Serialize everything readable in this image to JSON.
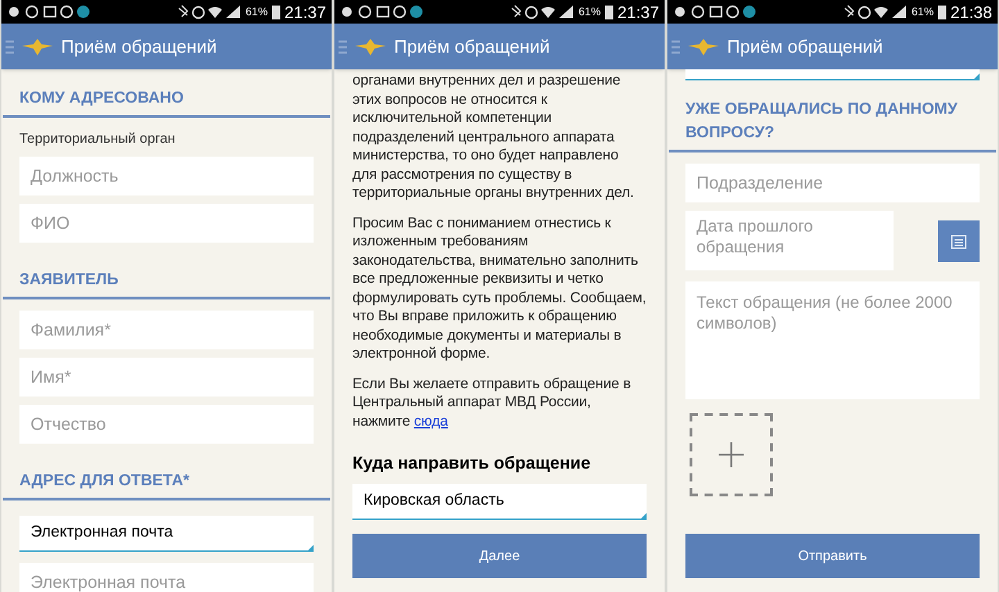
{
  "screens": [
    {
      "status_bar": {
        "battery": "61%",
        "time": "21:37"
      },
      "app_bar": {
        "title": "Приём обращений"
      },
      "content": [
        {
          "kind": "section",
          "text": "КОМУ АДРЕСОВАНО"
        },
        {
          "kind": "label",
          "text": "Территориальный орган"
        },
        {
          "kind": "input",
          "placeholder": "Должность"
        },
        {
          "kind": "input",
          "placeholder": "ФИО"
        },
        {
          "kind": "section",
          "text": "ЗАЯВИТЕЛЬ"
        },
        {
          "kind": "input",
          "placeholder": "Фамилия*"
        },
        {
          "kind": "input",
          "placeholder": "Имя*"
        },
        {
          "kind": "input",
          "placeholder": "Отчество"
        },
        {
          "kind": "section",
          "text": "АДРЕС ДЛЯ ОТВЕТА*"
        },
        {
          "kind": "select",
          "value": "Электронная почта"
        },
        {
          "kind": "input",
          "placeholder": "Электронная почта"
        }
      ]
    },
    {
      "status_bar": {
        "battery": "61%",
        "time": "21:37"
      },
      "app_bar": {
        "title": "Приём обращений"
      },
      "content": [
        {
          "kind": "paragraph",
          "text": "органами внутренних дел и разрешение этих вопросов не относится к исключительной компетенции подразделений центрального аппарата министерства, то оно будет направлено для рассмотрения по существу в территориальные органы внутренних дел."
        },
        {
          "kind": "paragraph",
          "text": "Просим Вас с пониманием отнестись к изложенным требованиям законодательства, внимательно заполнить все предложенные реквизиты и четко формулировать суть проблемы. Сообщаем, что Вы вправе приложить к обращению необходимые документы и материалы в электронной форме."
        },
        {
          "kind": "paragraph",
          "text": "Если Вы желаете отправить обращение в Центральный аппарат МВД России, нажмите",
          "link": "сюда"
        },
        {
          "kind": "heading",
          "text": "Куда направить обращение"
        },
        {
          "kind": "select",
          "value": "Кировская область"
        },
        {
          "kind": "button",
          "text": "Далее"
        }
      ]
    },
    {
      "status_bar": {
        "battery": "61%",
        "time": "21:38"
      },
      "app_bar": {
        "title": "Приём обращений"
      },
      "content": [
        {
          "kind": "select_cut"
        },
        {
          "kind": "section",
          "text": "УЖЕ ОБРАЩАЛИСЬ ПО ДАННОМУ ВОПРОСУ?"
        },
        {
          "kind": "input",
          "placeholder": "Подразделение"
        },
        {
          "kind": "date",
          "placeholder": "Дата прошлого обращения"
        },
        {
          "kind": "textarea",
          "placeholder": "Текст обращения (не более 2000 символов)"
        },
        {
          "kind": "attach"
        },
        {
          "kind": "button",
          "text": "Отправить"
        }
      ]
    }
  ]
}
